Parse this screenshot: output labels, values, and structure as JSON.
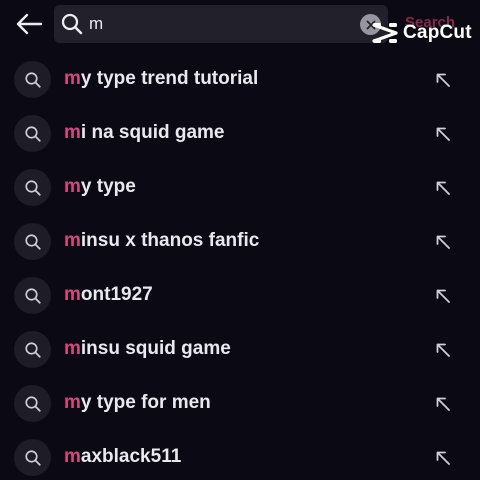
{
  "search": {
    "query": "m",
    "action_label": "Search"
  },
  "watermark": {
    "brand": "CapCut"
  },
  "suggestions": [
    {
      "match": "m",
      "rest": "y type trend tutorial"
    },
    {
      "match": "m",
      "rest": "i na squid game"
    },
    {
      "match": "m",
      "rest": "y type"
    },
    {
      "match": "m",
      "rest": "insu x thanos fanfic"
    },
    {
      "match": "m",
      "rest": "ont1927"
    },
    {
      "match": "m",
      "rest": "insu squid game"
    },
    {
      "match": "m",
      "rest": "y type for men"
    },
    {
      "match": "m",
      "rest": "axblack511"
    }
  ],
  "colors": {
    "background": "#0b0a14",
    "highlight": "#d4487e",
    "search_action": "#b0355e"
  },
  "icons": {
    "back": "arrow-left-icon",
    "search": "search-icon",
    "clear": "clear-x-icon",
    "fill": "arrow-up-left-icon",
    "brand": "capcut-logo"
  }
}
